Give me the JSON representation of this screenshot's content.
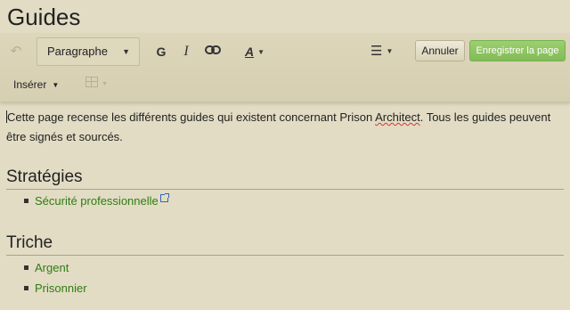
{
  "page": {
    "title": "Guides"
  },
  "toolbar": {
    "undo_icon": "undo-icon",
    "format_select": {
      "value": "Paragraphe"
    },
    "bold_label": "G",
    "italic_label": "I",
    "link_icon": "link-icon",
    "text_style_label": "A",
    "list_icon": "list-icon",
    "cancel_label": "Annuler",
    "save_label": "Enregistrer la page",
    "insert_label": "Insérer",
    "table_icon": "table-icon",
    "save_color": "#8cc461"
  },
  "content": {
    "intro_before": "Cette page recense les différents guides qui existent concernant Prison ",
    "intro_misspelled": "Architect",
    "intro_after": ". Tous les guides peuvent être signés et sourcés.",
    "sections": [
      {
        "heading": "Stratégies",
        "items": [
          {
            "label": "Sécurité professionnelle",
            "external": true
          }
        ]
      },
      {
        "heading": "Triche",
        "items": [
          {
            "label": "Argent"
          },
          {
            "label": "Prisonnier"
          }
        ]
      }
    ],
    "link_color": "#2e7d12"
  }
}
